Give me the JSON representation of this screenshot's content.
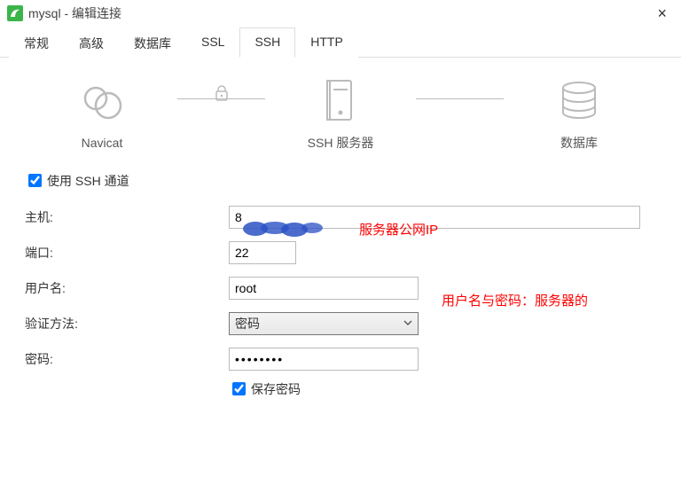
{
  "window": {
    "title": "mysql - 编辑连接",
    "close_glyph": "×"
  },
  "tabs": {
    "items": [
      {
        "label": "常规"
      },
      {
        "label": "高级"
      },
      {
        "label": "数据库"
      },
      {
        "label": "SSL"
      },
      {
        "label": "SSH"
      },
      {
        "label": "HTTP"
      }
    ],
    "active_index": 4
  },
  "diagram": {
    "navicat_label": "Navicat",
    "ssh_label": "SSH 服务器",
    "db_label": "数据库"
  },
  "form": {
    "use_ssh_label": "使用 SSH 通道",
    "use_ssh_checked": true,
    "host_label": "主机:",
    "host_value": "8",
    "port_label": "端口:",
    "port_value": "22",
    "user_label": "用户名:",
    "user_value": "root",
    "auth_label": "验证方法:",
    "auth_value": "密码",
    "password_label": "密码:",
    "password_value": "••••••••",
    "save_password_label": "保存密码",
    "save_password_checked": true
  },
  "annotations": {
    "public_ip": "服务器公网IP",
    "user_pass_note": "用户名与密码：服务器的"
  }
}
